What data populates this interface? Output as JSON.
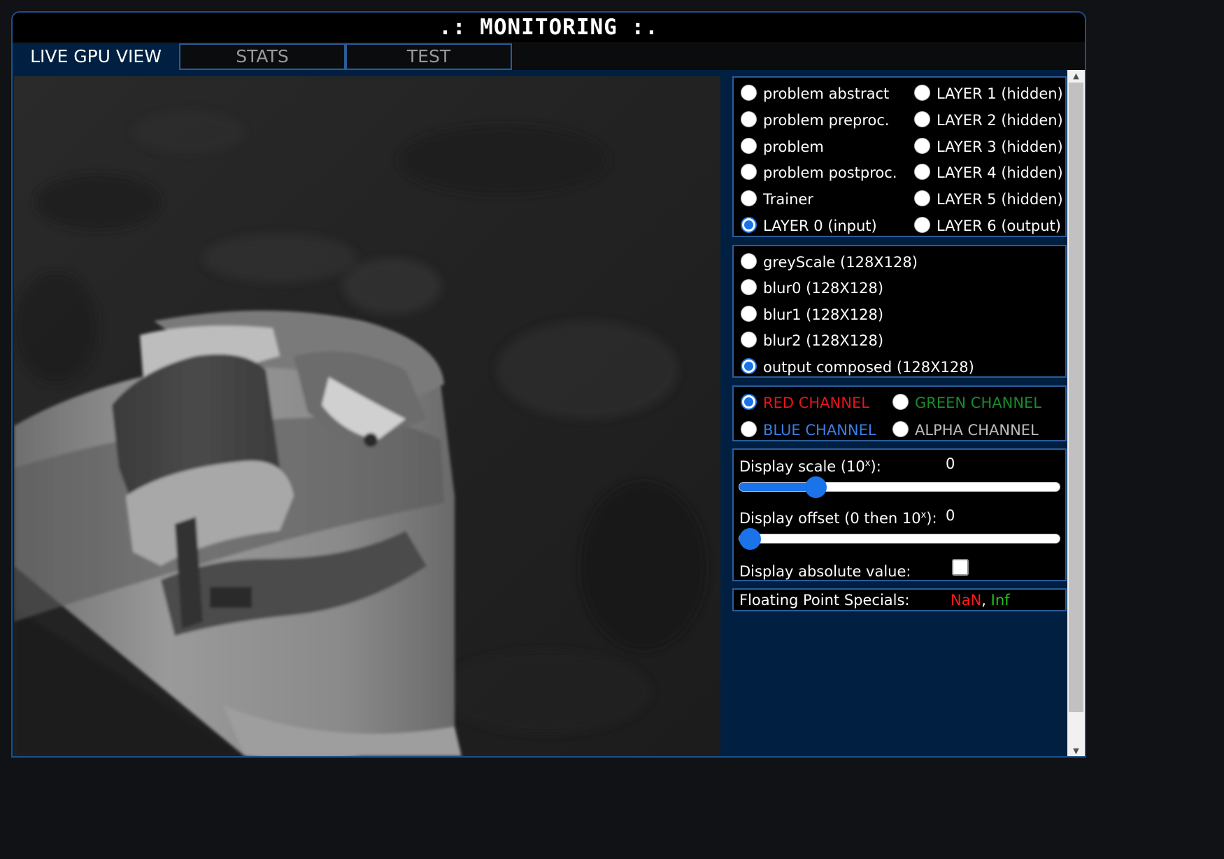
{
  "window": {
    "title": ".: MONITORING :."
  },
  "tabs": [
    {
      "label": "LIVE GPU VIEW",
      "active": true
    },
    {
      "label": "STATS",
      "active": false
    },
    {
      "label": "TEST",
      "active": false
    }
  ],
  "viewport": {
    "content": "live GPU layer output render (greyscale)"
  },
  "source_group": {
    "selected": "LAYER 0 (input)",
    "left": [
      "problem abstract",
      "problem preproc.",
      "problem",
      "problem postproc.",
      "Trainer",
      "LAYER 0 (input)"
    ],
    "right": [
      "LAYER 1 (hidden)",
      "LAYER 2 (hidden)",
      "LAYER 3 (hidden)",
      "LAYER 4 (hidden)",
      "LAYER 5 (hidden)",
      "LAYER 6 (output)"
    ]
  },
  "buffer_group": {
    "selected": "output composed (128X128)",
    "items": [
      "greyScale (128X128)",
      "blur0 (128X128)",
      "blur1 (128X128)",
      "blur2 (128X128)",
      "output composed (128X128)"
    ]
  },
  "channel_group": {
    "selected": "RED CHANNEL",
    "red": {
      "label": "RED CHANNEL",
      "color": "#e8141a"
    },
    "green": {
      "label": "GREEN CHANNEL",
      "color": "#1a8a2a"
    },
    "blue": {
      "label": "BLUE CHANNEL",
      "color": "#3a7fe8"
    },
    "alpha": {
      "label": "ALPHA CHANNEL",
      "color": "#bdbdbd"
    }
  },
  "display": {
    "scale_label": "Display scale (10",
    "scale_exp": "x",
    "scale_suffix": "):",
    "scale_value": "0",
    "scale_slider_fraction": 0.22,
    "offset_label": "Display offset (0 then 10",
    "offset_exp": "x",
    "offset_suffix": "):",
    "offset_value": "0",
    "offset_slider_fraction": 0.0,
    "absolute_label": "Display absolute value:",
    "absolute_checked": false
  },
  "specials": {
    "label": "Floating Point Specials:",
    "nan": "NaN",
    "sep": ",",
    "inf": "Inf",
    "nan_color": "#ff1a1a",
    "inf_color": "#22c022"
  },
  "colors": {
    "accent": "#1a73e8",
    "panel_bg": "#012041",
    "border": "#2b5c96"
  }
}
